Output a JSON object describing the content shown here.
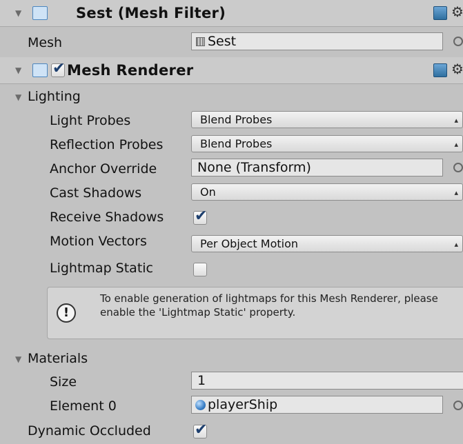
{
  "mesh_filter": {
    "title": "Sest (Mesh Filter)",
    "icon": "mesh-filter-icon",
    "mesh_label": "Mesh",
    "mesh_value": "Sest"
  },
  "mesh_renderer": {
    "title": "Mesh Renderer",
    "enabled": true,
    "icon": "mesh-renderer-icon"
  },
  "lighting": {
    "section_label": "Lighting",
    "light_probes_label": "Light Probes",
    "light_probes_value": "Blend Probes",
    "reflection_probes_label": "Reflection Probes",
    "reflection_probes_value": "Blend Probes",
    "anchor_override_label": "Anchor Override",
    "anchor_override_value": "None (Transform)",
    "cast_shadows_label": "Cast Shadows",
    "cast_shadows_value": "On",
    "receive_shadows_label": "Receive Shadows",
    "receive_shadows_checked": true,
    "motion_vectors_label": "Motion Vectors",
    "motion_vectors_value": "Per Object Motion",
    "lightmap_static_label": "Lightmap Static",
    "lightmap_static_checked": false,
    "help_text": "To enable generation of lightmaps for this Mesh Renderer, please enable the 'Lightmap Static' property."
  },
  "materials": {
    "section_label": "Materials",
    "size_label": "Size",
    "size_value": "1",
    "element0_label": "Element 0",
    "element0_value": "playerShip"
  },
  "dynamic_occluded": {
    "label": "Dynamic Occluded",
    "checked": true
  },
  "colors": {
    "background": "#c2c2c2",
    "header": "#cbcbcb",
    "field": "#e6e6e6",
    "accent": "#2f6f9f"
  }
}
